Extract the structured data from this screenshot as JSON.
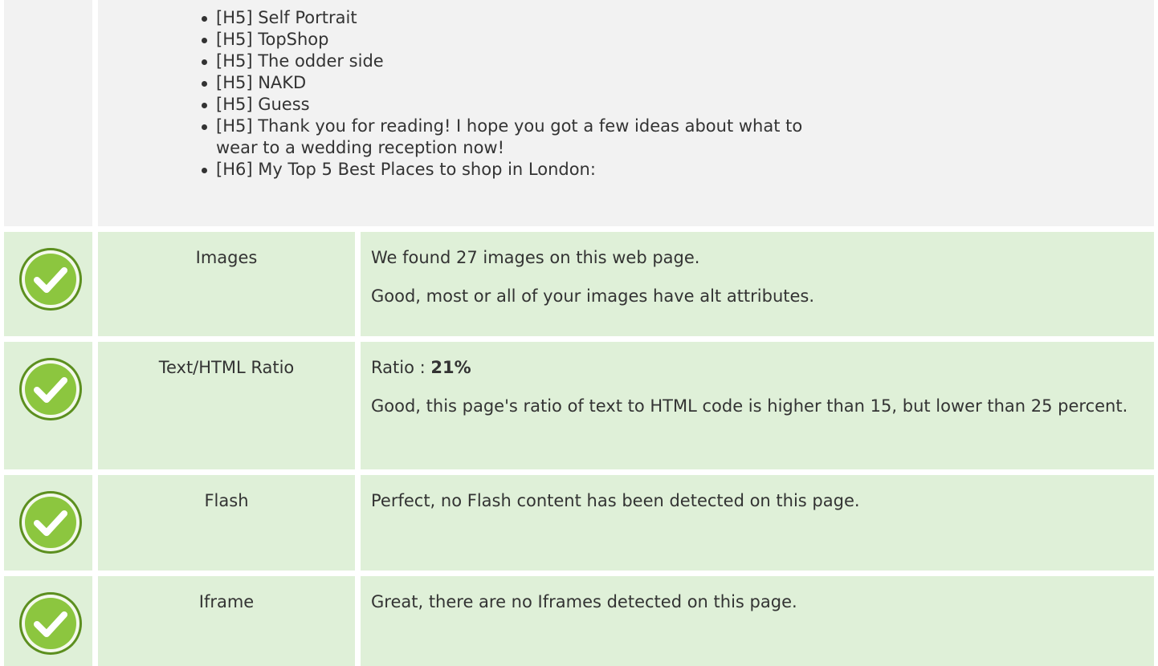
{
  "headings": {
    "items": [
      "[H5] Self Portrait",
      "[H5] TopShop",
      "[H5] The odder side",
      "[H5] NAKD",
      "[H5] Guess",
      "[H5] Thank you for reading! I hope you got a few ideas about what to wear to a wedding reception now!",
      "[H6] My Top 5 Best Places to shop in London:"
    ]
  },
  "images": {
    "icon": "check-circle-icon",
    "label": "Images",
    "line1": "We found 27 images on this web page.",
    "line2": "Good, most or all of your images have alt attributes."
  },
  "ratio": {
    "icon": "check-circle-icon",
    "label": "Text/HTML Ratio",
    "prefix": "Ratio : ",
    "value": "21%",
    "line2": "Good, this page's ratio of text to HTML code is higher than 15, but lower than 25 percent."
  },
  "flash": {
    "icon": "check-circle-icon",
    "label": "Flash",
    "line1": "Perfect, no Flash content has been detected on this page."
  },
  "iframe": {
    "icon": "check-circle-icon",
    "label": "Iframe",
    "line1": "Great, there are no Iframes detected on this page."
  },
  "colors": {
    "ok_row_bg": "#dff0d8",
    "neutral_row_bg": "#f2f2f2",
    "check_green": "#8cc63f",
    "check_dark": "#5c8f1f"
  }
}
